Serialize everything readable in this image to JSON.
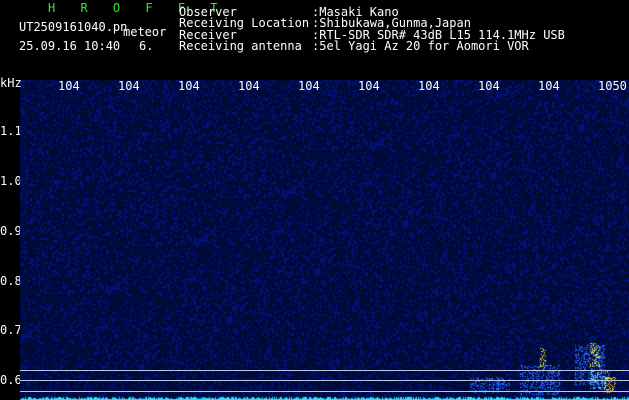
{
  "header": {
    "title": "H R O F F T",
    "filename": "UT2509161040.pn",
    "tag": "meteor",
    "datetime": "25.09.16 10:40",
    "count": "6."
  },
  "info": {
    "observer_label": "Observer",
    "observer_value": ":Masaki Kano",
    "location_label": "Receiving Location",
    "location_value": ":Shibukawa,Gunma,Japan",
    "receiver_label": "Receiver",
    "receiver_value": ":RTL-SDR SDR# 43dB L15 114.1MHz USB",
    "antenna_label": "Receiving antenna",
    "antenna_value": ":5el Yagi Az 20 for Aomori VOR"
  },
  "plot": {
    "y_unit": "kHz",
    "top_ticks": [
      "104",
      "104",
      "104",
      "104",
      "104",
      "104",
      "104",
      "104",
      "104",
      "1050"
    ],
    "left_ticks": [
      "1.1",
      "1.0",
      "0.9",
      "0.8",
      "0.7",
      "0.6"
    ],
    "colors": {
      "background": "#000a33",
      "text": "#ffffff",
      "title": "#33e633",
      "reference_line": "#bfc8e0"
    }
  }
}
